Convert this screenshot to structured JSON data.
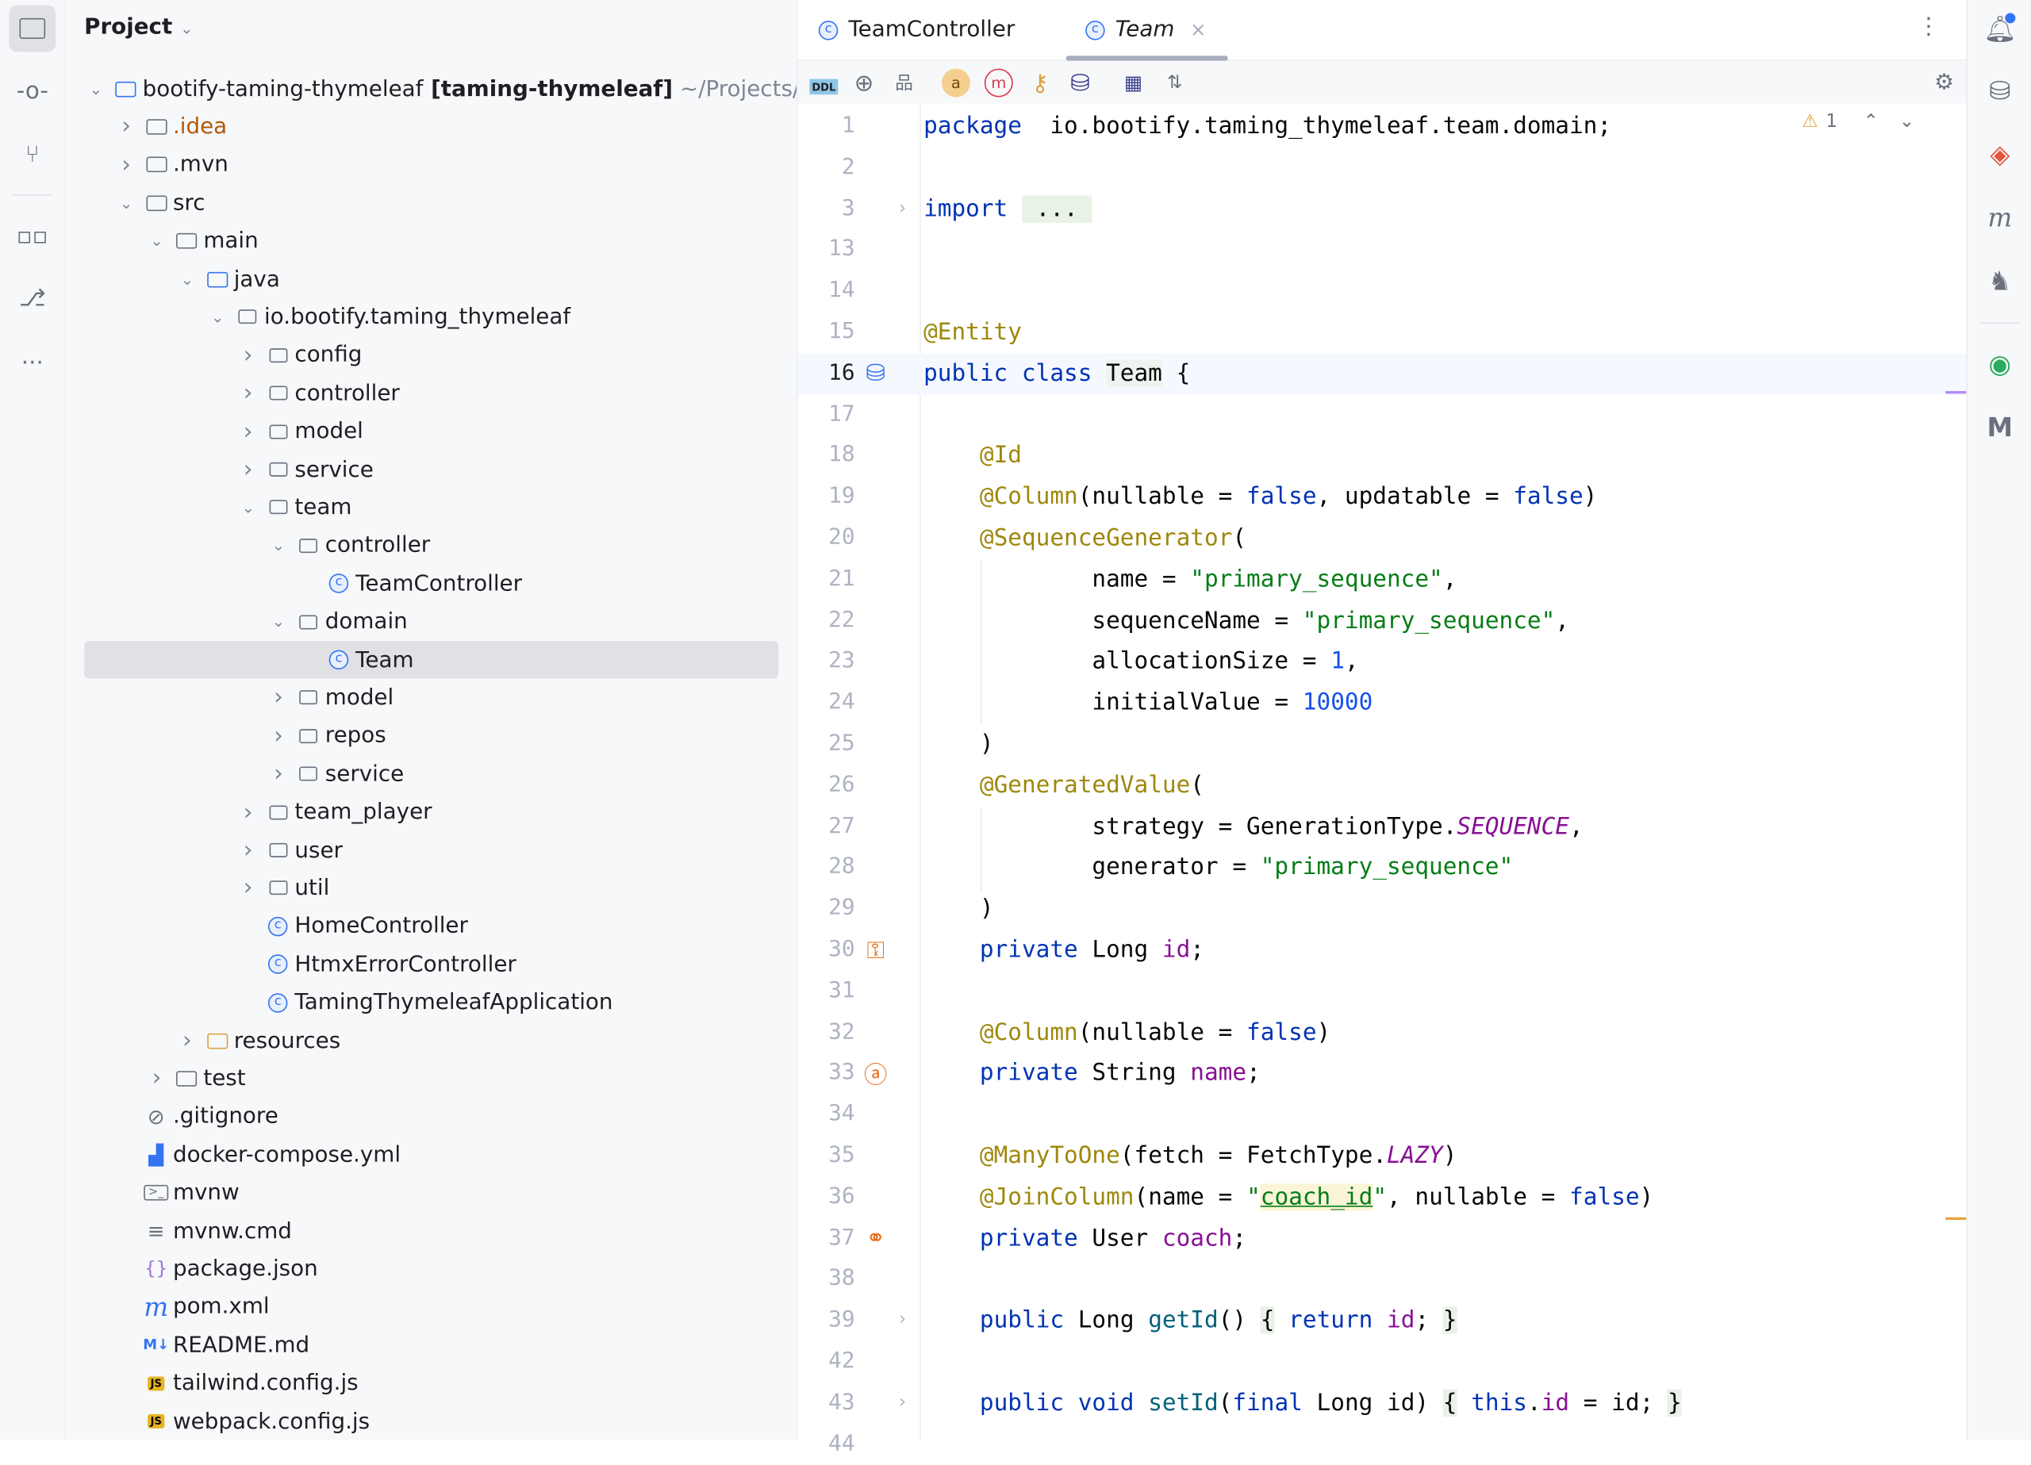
{
  "project": {
    "title": "Project",
    "items": [
      {
        "level": 0,
        "chev": "open",
        "icon": "module",
        "label": "bootify-taming-thymeleaf",
        "bold": " [taming-thymeleaf]",
        "extra": "  ~/Projects/"
      },
      {
        "level": 1,
        "chev": "closed",
        "icon": "folder",
        "label": ".idea",
        "color": "#b3590a"
      },
      {
        "level": 1,
        "chev": "closed",
        "icon": "folder",
        "label": ".mvn"
      },
      {
        "level": 1,
        "chev": "open",
        "icon": "folder",
        "label": "src"
      },
      {
        "level": 2,
        "chev": "open",
        "icon": "folder",
        "label": "main"
      },
      {
        "level": 3,
        "chev": "open",
        "icon": "source-folder",
        "label": "java"
      },
      {
        "level": 4,
        "chev": "open",
        "icon": "package",
        "label": "io.bootify.taming_thymeleaf"
      },
      {
        "level": 5,
        "chev": "closed",
        "icon": "package",
        "label": "config"
      },
      {
        "level": 5,
        "chev": "closed",
        "icon": "package",
        "label": "controller"
      },
      {
        "level": 5,
        "chev": "closed",
        "icon": "package",
        "label": "model"
      },
      {
        "level": 5,
        "chev": "closed",
        "icon": "package",
        "label": "service"
      },
      {
        "level": 5,
        "chev": "open",
        "icon": "package",
        "label": "team"
      },
      {
        "level": 6,
        "chev": "open",
        "icon": "package",
        "label": "controller"
      },
      {
        "level": 7,
        "chev": "none",
        "icon": "class",
        "label": "TeamController"
      },
      {
        "level": 6,
        "chev": "open",
        "icon": "package",
        "label": "domain"
      },
      {
        "level": 7,
        "chev": "none",
        "icon": "class",
        "label": "Team",
        "selected": true
      },
      {
        "level": 6,
        "chev": "closed",
        "icon": "package",
        "label": "model"
      },
      {
        "level": 6,
        "chev": "closed",
        "icon": "package",
        "label": "repos"
      },
      {
        "level": 6,
        "chev": "closed",
        "icon": "package",
        "label": "service"
      },
      {
        "level": 5,
        "chev": "closed",
        "icon": "package",
        "label": "team_player"
      },
      {
        "level": 5,
        "chev": "closed",
        "icon": "package",
        "label": "user"
      },
      {
        "level": 5,
        "chev": "closed",
        "icon": "package",
        "label": "util"
      },
      {
        "level": 5,
        "chev": "none",
        "icon": "class",
        "label": "HomeController"
      },
      {
        "level": 5,
        "chev": "none",
        "icon": "class",
        "label": "HtmxErrorController"
      },
      {
        "level": 5,
        "chev": "none",
        "icon": "spring-class",
        "label": "TamingThymeleafApplication"
      },
      {
        "level": 3,
        "chev": "closed",
        "icon": "resources-folder",
        "label": "resources"
      },
      {
        "level": 2,
        "chev": "closed",
        "icon": "folder",
        "label": "test"
      },
      {
        "level": 1,
        "chev": "none",
        "icon": "ignore",
        "label": ".gitignore"
      },
      {
        "level": 1,
        "chev": "none",
        "icon": "docker",
        "label": "docker-compose.yml"
      },
      {
        "level": 1,
        "chev": "none",
        "icon": "shell",
        "label": "mvnw"
      },
      {
        "level": 1,
        "chev": "none",
        "icon": "text",
        "label": "mvnw.cmd"
      },
      {
        "level": 1,
        "chev": "none",
        "icon": "json",
        "label": "package.json"
      },
      {
        "level": 1,
        "chev": "none",
        "icon": "maven",
        "label": "pom.xml"
      },
      {
        "level": 1,
        "chev": "none",
        "icon": "markdown",
        "label": "README.md"
      },
      {
        "level": 1,
        "chev": "none",
        "icon": "js",
        "label": "tailwind.config.js"
      },
      {
        "level": 1,
        "chev": "none",
        "icon": "js",
        "label": "webpack.config.js"
      }
    ]
  },
  "tabs": [
    {
      "label": "TeamController",
      "active": false
    },
    {
      "label": "Team",
      "active": true,
      "close": "×"
    }
  ],
  "inspection": {
    "warnings": "1"
  },
  "code": [
    {
      "n": "1",
      "t": [
        [
          "kw",
          "package"
        ],
        [
          "",
          "  io.bootify.taming_thymeleaf.team.domain;"
        ]
      ]
    },
    {
      "n": "2",
      "t": []
    },
    {
      "n": "3",
      "fold": true,
      "t": [
        [
          "kw",
          "import"
        ],
        [
          "",
          " "
        ],
        [
          "fb",
          " ... "
        ]
      ]
    },
    {
      "n": "13",
      "t": []
    },
    {
      "n": "14",
      "t": []
    },
    {
      "n": "15",
      "t": [
        [
          "an",
          "@Entity"
        ]
      ]
    },
    {
      "n": "16",
      "cur": true,
      "gicon": "db-table",
      "t": [
        [
          "kw",
          "public class"
        ],
        [
          "",
          " "
        ],
        [
          "hl",
          "Team"
        ],
        [
          "",
          " {"
        ]
      ]
    },
    {
      "n": "17",
      "t": []
    },
    {
      "n": "18",
      "t": [
        [
          "",
          "    "
        ],
        [
          "an",
          "@Id"
        ]
      ]
    },
    {
      "n": "19",
      "t": [
        [
          "",
          "    "
        ],
        [
          "an",
          "@Column"
        ],
        [
          "",
          "(nullable = "
        ],
        [
          "kw",
          "false"
        ],
        [
          "",
          ", updatable = "
        ],
        [
          "kw",
          "false"
        ],
        [
          "",
          ")"
        ]
      ]
    },
    {
      "n": "20",
      "t": [
        [
          "",
          "    "
        ],
        [
          "an",
          "@SequenceGenerator"
        ],
        [
          "",
          "("
        ]
      ]
    },
    {
      "n": "21",
      "t": [
        [
          "",
          "            name = "
        ],
        [
          "st",
          "\"primary_sequence\""
        ],
        [
          "",
          ","
        ]
      ]
    },
    {
      "n": "22",
      "t": [
        [
          "",
          "            sequenceName = "
        ],
        [
          "st",
          "\"primary_sequence\""
        ],
        [
          "",
          ","
        ]
      ]
    },
    {
      "n": "23",
      "t": [
        [
          "",
          "            allocationSize = "
        ],
        [
          "nu",
          "1"
        ],
        [
          "",
          ","
        ]
      ]
    },
    {
      "n": "24",
      "t": [
        [
          "",
          "            initialValue = "
        ],
        [
          "nu",
          "10000"
        ]
      ]
    },
    {
      "n": "25",
      "t": [
        [
          "",
          "    )"
        ]
      ]
    },
    {
      "n": "26",
      "t": [
        [
          "",
          "    "
        ],
        [
          "an",
          "@GeneratedValue"
        ],
        [
          "",
          "("
        ]
      ]
    },
    {
      "n": "27",
      "t": [
        [
          "",
          "            strategy = GenerationType."
        ],
        [
          "sf",
          "SEQUENCE"
        ],
        [
          "",
          ","
        ]
      ]
    },
    {
      "n": "28",
      "t": [
        [
          "",
          "            generator = "
        ],
        [
          "st",
          "\"primary_sequence\""
        ]
      ]
    },
    {
      "n": "29",
      "t": [
        [
          "",
          "    )"
        ]
      ]
    },
    {
      "n": "30",
      "gicon": "id-key",
      "t": [
        [
          "",
          "    "
        ],
        [
          "kw",
          "private"
        ],
        [
          "",
          " Long "
        ],
        [
          "fd",
          "id"
        ],
        [
          "",
          ";"
        ]
      ]
    },
    {
      "n": "31",
      "t": []
    },
    {
      "n": "32",
      "t": [
        [
          "",
          "    "
        ],
        [
          "an",
          "@Column"
        ],
        [
          "",
          "(nullable = "
        ],
        [
          "kw",
          "false"
        ],
        [
          "",
          ")"
        ]
      ]
    },
    {
      "n": "33",
      "gicon": "attribute",
      "t": [
        [
          "",
          "    "
        ],
        [
          "kw",
          "private"
        ],
        [
          "",
          " String "
        ],
        [
          "fd",
          "name"
        ],
        [
          "",
          ";"
        ]
      ]
    },
    {
      "n": "34",
      "t": []
    },
    {
      "n": "35",
      "t": [
        [
          "",
          "    "
        ],
        [
          "an",
          "@ManyToOne"
        ],
        [
          "",
          "(fetch = FetchType."
        ],
        [
          "sf",
          "LAZY"
        ],
        [
          "",
          ")"
        ]
      ]
    },
    {
      "n": "36",
      "t": [
        [
          "",
          "    "
        ],
        [
          "an",
          "@JoinColumn"
        ],
        [
          "",
          "(name = "
        ],
        [
          "st",
          "\""
        ],
        [
          "st tk-u",
          "coach_id"
        ],
        [
          "st",
          "\""
        ],
        [
          "",
          ", nullable = "
        ],
        [
          "kw",
          "false"
        ],
        [
          "",
          ")"
        ]
      ]
    },
    {
      "n": "37",
      "gicon": "relation",
      "t": [
        [
          "",
          "    "
        ],
        [
          "kw",
          "private"
        ],
        [
          "",
          " User "
        ],
        [
          "fd",
          "coach"
        ],
        [
          "",
          ";"
        ]
      ]
    },
    {
      "n": "38",
      "t": []
    },
    {
      "n": "39",
      "fold": true,
      "t": [
        [
          "",
          "    "
        ],
        [
          "kw",
          "public"
        ],
        [
          "",
          " Long "
        ],
        [
          "md",
          "getId"
        ],
        [
          "",
          "() "
        ],
        [
          "fb",
          "{"
        ],
        [
          "",
          " "
        ],
        [
          "kw",
          "return"
        ],
        [
          "",
          " "
        ],
        [
          "fd",
          "id"
        ],
        [
          "",
          "; "
        ],
        [
          "fb",
          "}"
        ]
      ]
    },
    {
      "n": "42",
      "t": []
    },
    {
      "n": "43",
      "fold": true,
      "t": [
        [
          "",
          "    "
        ],
        [
          "kw",
          "public void"
        ],
        [
          "",
          " "
        ],
        [
          "md",
          "setId"
        ],
        [
          "",
          "("
        ],
        [
          "kw",
          "final"
        ],
        [
          "",
          " Long id) "
        ],
        [
          "fb",
          "{"
        ],
        [
          "",
          " "
        ],
        [
          "kw",
          "this"
        ],
        [
          "",
          "."
        ],
        [
          "fd",
          "id"
        ],
        [
          "",
          " = id; "
        ],
        [
          "fb",
          "}"
        ]
      ]
    },
    {
      "n": "44",
      "t": []
    }
  ]
}
